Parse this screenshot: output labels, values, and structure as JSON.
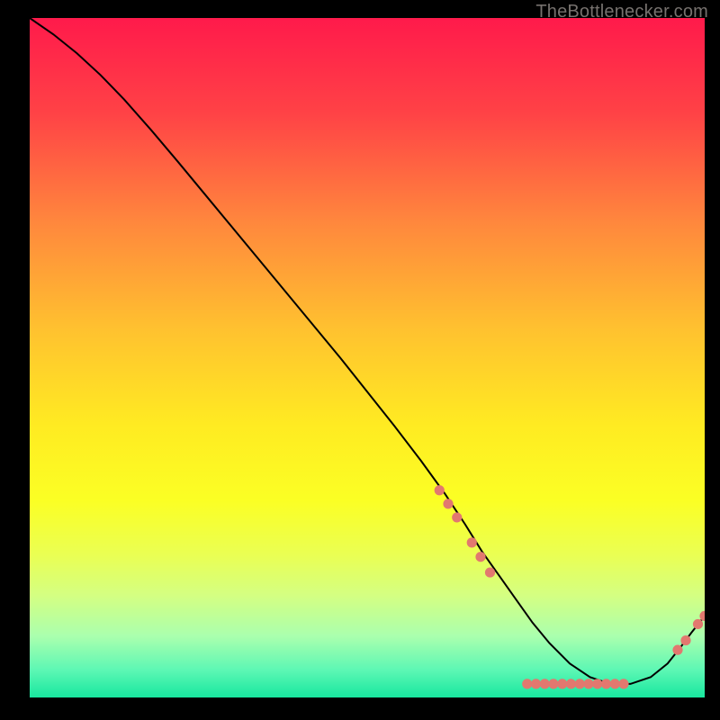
{
  "watermark": "TheBottlenecker.com",
  "chart_data": {
    "type": "line",
    "title": "",
    "xlabel": "",
    "ylabel": "",
    "xlim": [
      0,
      100
    ],
    "ylim": [
      0,
      100
    ],
    "background": {
      "type": "vertical-gradient",
      "stops_100": [
        {
          "pct": 0,
          "color": "#ff1a4b"
        },
        {
          "pct": 14,
          "color": "#ff4246"
        },
        {
          "pct": 30,
          "color": "#ff873d"
        },
        {
          "pct": 46,
          "color": "#ffc22f"
        },
        {
          "pct": 60,
          "color": "#ffeb22"
        },
        {
          "pct": 71,
          "color": "#fbff24"
        },
        {
          "pct": 79,
          "color": "#eaff53"
        },
        {
          "pct": 85,
          "color": "#d4ff82"
        },
        {
          "pct": 91,
          "color": "#aaffae"
        },
        {
          "pct": 96,
          "color": "#5cf7b4"
        },
        {
          "pct": 100,
          "color": "#18e79f"
        }
      ]
    },
    "series": [
      {
        "name": "bottleneck-curve",
        "color": "#000000",
        "x": [
          0.0,
          3.5,
          7.0,
          10.5,
          14.0,
          18.0,
          22.0,
          26.0,
          30.0,
          34.0,
          38.0,
          42.0,
          46.0,
          50.0,
          54.0,
          58.0,
          61.5,
          64.5,
          67.0,
          69.5,
          72.0,
          74.5,
          77.0,
          80.0,
          83.0,
          86.0,
          89.0,
          92.0,
          94.5,
          96.5,
          98.0,
          100.0
        ],
        "y": [
          100.0,
          97.6,
          94.8,
          91.6,
          88.0,
          83.5,
          78.8,
          74.0,
          69.2,
          64.4,
          59.6,
          54.8,
          50.0,
          45.0,
          40.0,
          34.8,
          30.0,
          25.5,
          21.5,
          18.0,
          14.5,
          11.0,
          8.0,
          5.0,
          3.0,
          2.0,
          2.0,
          3.0,
          5.0,
          7.5,
          9.5,
          12.0
        ]
      }
    ],
    "markers": {
      "color": "#e2786f",
      "radius": 5.6,
      "points": [
        {
          "x": 60.7,
          "y": 30.5
        },
        {
          "x": 62.0,
          "y": 28.5
        },
        {
          "x": 63.3,
          "y": 26.5
        },
        {
          "x": 65.5,
          "y": 22.8
        },
        {
          "x": 66.8,
          "y": 20.7
        },
        {
          "x": 68.2,
          "y": 18.4
        },
        {
          "x": 73.7,
          "y": 2.0
        },
        {
          "x": 75.0,
          "y": 2.0
        },
        {
          "x": 76.3,
          "y": 2.0
        },
        {
          "x": 77.6,
          "y": 2.0
        },
        {
          "x": 78.9,
          "y": 2.0
        },
        {
          "x": 80.2,
          "y": 2.0
        },
        {
          "x": 81.5,
          "y": 2.0
        },
        {
          "x": 82.8,
          "y": 2.0
        },
        {
          "x": 84.1,
          "y": 2.0
        },
        {
          "x": 85.4,
          "y": 2.0
        },
        {
          "x": 86.7,
          "y": 2.0
        },
        {
          "x": 88.0,
          "y": 2.0
        },
        {
          "x": 96.0,
          "y": 7.0
        },
        {
          "x": 97.2,
          "y": 8.4
        },
        {
          "x": 99.0,
          "y": 10.8
        },
        {
          "x": 100.0,
          "y": 12.0
        }
      ]
    }
  }
}
